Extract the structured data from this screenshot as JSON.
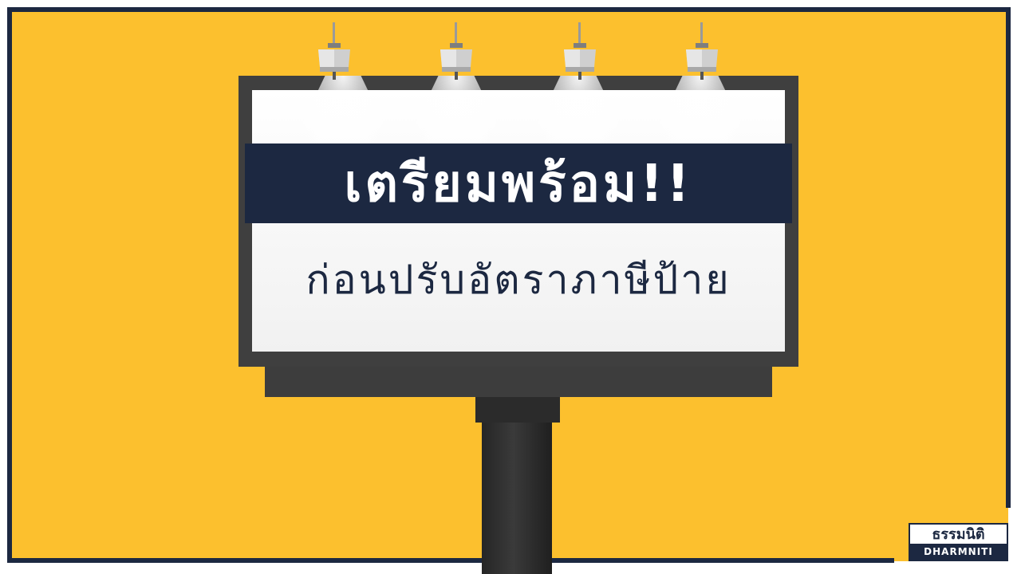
{
  "billboard": {
    "headline": "เตรียมพร้อม!!",
    "subline": "ก่อนปรับอัตราภาษีป้าย"
  },
  "logo": {
    "thai": "ธรรมนิติ",
    "english": "DHARMNITI"
  },
  "colors": {
    "background": "#fcc02e",
    "navy": "#1c2841",
    "board_frame": "#3f3f3f",
    "board_face": "#ffffff"
  },
  "icons": [
    "spotlight-lamp-icon"
  ]
}
